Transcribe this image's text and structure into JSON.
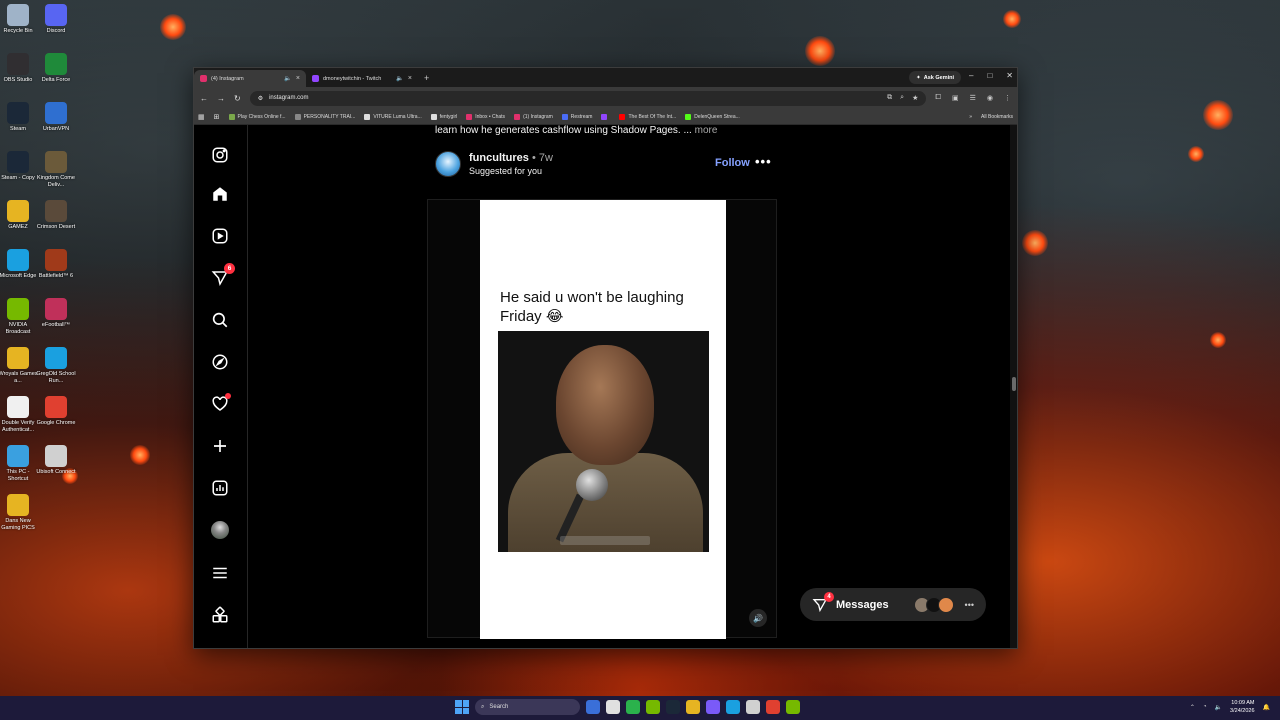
{
  "desktop": {
    "icons": [
      {
        "label": "Recycle Bin",
        "color": "#9fb3c8"
      },
      {
        "label": "Discord",
        "color": "#5865f2"
      },
      {
        "label": "OBS Studio",
        "color": "#302e31"
      },
      {
        "label": "Delta Force",
        "color": "#1f8a3a"
      },
      {
        "label": "Steam",
        "color": "#1b2838"
      },
      {
        "label": "UrbanVPN",
        "color": "#2f6fd0"
      },
      {
        "label": "Steam - Copy",
        "color": "#1b2838"
      },
      {
        "label": "Kingdom Come Deliv...",
        "color": "#6b5a3a"
      },
      {
        "label": "GAMEZ",
        "color": "#e6b422"
      },
      {
        "label": "Crimson Desert",
        "color": "#5a4a3a"
      },
      {
        "label": "Microsoft Edge",
        "color": "#1aa0e0"
      },
      {
        "label": "Battlefield™ 6",
        "color": "#a03a1a"
      },
      {
        "label": "NVIDIA Broadcast",
        "color": "#76b900"
      },
      {
        "label": "eFootball™",
        "color": "#c0305a"
      },
      {
        "label": "Wroyals Games a...",
        "color": "#e6b422"
      },
      {
        "label": "GregOld School Run...",
        "color": "#1aa0e0"
      },
      {
        "label": "Double Verify Authenticat...",
        "color": "#f0f0f0"
      },
      {
        "label": "Google Chrome",
        "color": "#e04030"
      },
      {
        "label": "This PC - Shortcut",
        "color": "#3aa0e0"
      },
      {
        "label": "Ubisoft Connect",
        "color": "#d0d0d0"
      },
      {
        "label": "Dans New Gaming PICS",
        "color": "#e6b422"
      }
    ]
  },
  "browser": {
    "tabs": [
      {
        "title": "(4) Instagram",
        "color": "#e1306c",
        "active": true
      },
      {
        "title": "dmoneytwitchin - Twitch",
        "color": "#9146ff",
        "active": false
      }
    ],
    "new_tab": "+",
    "ask_gemini": "Ask Gemini",
    "url": "instagram.com",
    "bookmarks": [
      {
        "label": "Play Chess Online f...",
        "color": "#7aa84a"
      },
      {
        "label": "PERSONALITY TRAI...",
        "color": "#888888"
      },
      {
        "label": "VITURE Luma Ultra...",
        "color": "#dddddd"
      },
      {
        "label": "fentygirl",
        "color": "#dddddd"
      },
      {
        "label": "Inbox • Chats",
        "color": "#e1306c"
      },
      {
        "label": "(1) Instagram",
        "color": "#e1306c"
      },
      {
        "label": "Restream",
        "color": "#4a6cf7"
      },
      {
        "label": "",
        "color": "#9146ff"
      },
      {
        "label": "The Best Of The Int...",
        "color": "#ff0000"
      },
      {
        "label": "DelenQueen Strea...",
        "color": "#53fc18"
      }
    ],
    "all_bookmarks": "All Bookmarks"
  },
  "post": {
    "caption_tail": "learn how he generates cashflow using Shadow Pages. ...",
    "caption_more": "more",
    "username": "funcultures",
    "time": "• 7w",
    "suggested": "Suggested for you",
    "follow": "Follow",
    "meme_text": "He said u won't be laughing Friday 😂"
  },
  "sidebar": {
    "notifications_badge": "6"
  },
  "messages": {
    "label": "Messages",
    "badge": "4",
    "avatar_colors": [
      "#8a7a6a",
      "#111111",
      "#e0884a"
    ]
  },
  "taskbar": {
    "search": "Search",
    "time": "10:09 AM",
    "date": "3/24/2026",
    "apps": [
      "#3a6fd8",
      "#e0e0e0",
      "#2bb24c",
      "#76b900",
      "#1b2838",
      "#e6b422",
      "#7a5af8",
      "#1aa0e0",
      "#d0d0d0",
      "#e04030",
      "#76b900"
    ]
  }
}
